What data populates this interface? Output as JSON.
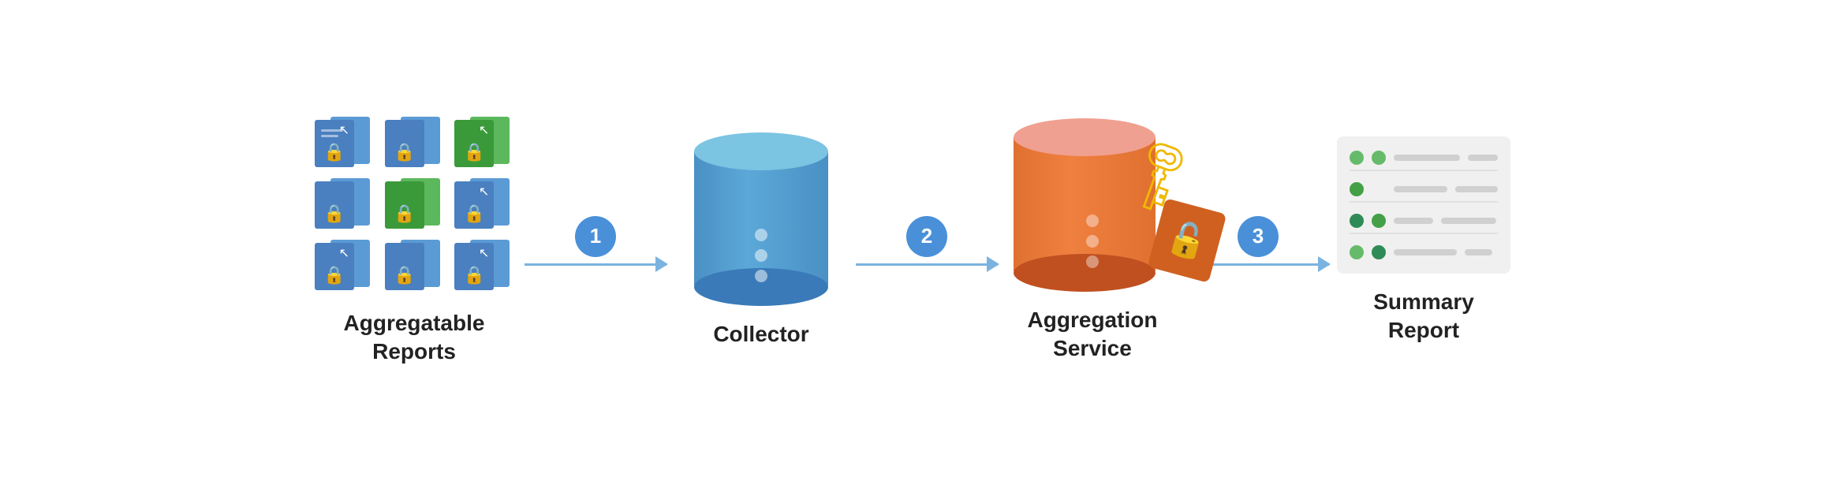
{
  "diagram": {
    "nodes": [
      {
        "id": "aggregatable-reports",
        "label": "Aggregatable\nReports",
        "label_line1": "Aggregatable",
        "label_line2": "Reports"
      },
      {
        "id": "collector",
        "label": "Collector",
        "label_line1": "Collector",
        "label_line2": ""
      },
      {
        "id": "aggregation-service",
        "label": "Aggregation\nService",
        "label_line1": "Aggregation",
        "label_line2": "Service"
      },
      {
        "id": "summary-report",
        "label": "Summary\nReport",
        "label_line1": "Summary",
        "label_line2": "Report"
      }
    ],
    "arrows": [
      {
        "id": "arrow1",
        "badge": "1"
      },
      {
        "id": "arrow2",
        "badge": "2"
      },
      {
        "id": "arrow3",
        "badge": "3"
      }
    ],
    "colors": {
      "blue_light": "#7bc4e2",
      "blue_main": "#4a90c4",
      "blue_dark": "#3a7ab8",
      "orange_light": "#f0a090",
      "orange_main": "#e07030",
      "orange_dark": "#c05020",
      "green_dark": "#2e8b57",
      "green_med": "#43a047",
      "green_light": "#66bb6a",
      "yellow": "#f0b800",
      "arrow_color": "#7ab3e0",
      "badge_color": "#4a90d9",
      "card_blue": "#5b9bd5",
      "card_green": "#5cb85c",
      "card_blue_dark": "#2a6099",
      "card_green_dark": "#3a7a3a"
    }
  }
}
